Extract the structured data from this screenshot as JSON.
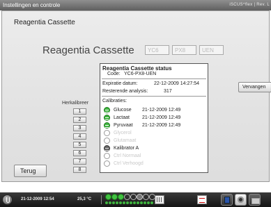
{
  "window": {
    "title": "Instellingen en controle",
    "brand": "iSCUS^flex | Rev. L"
  },
  "page": {
    "heading": "Reagentia Cassette"
  },
  "cassette": {
    "title": "Reagentia Cassette",
    "codes": [
      "YC6",
      "PX8",
      "UEN"
    ]
  },
  "status": {
    "title": "Reagentia Cassette status",
    "code_label": "Code:",
    "code_value": "YC6-PX8-UEN",
    "expiry_label": "Expiratie datum:",
    "expiry_value": "22-12-2009 14:27:54",
    "remaining_label": "Resterende analysis:",
    "remaining_value": "317",
    "calibrations_label": "Calibraties:",
    "calibrations": [
      {
        "name": "Glucose",
        "date": "21-12-2009 12:49",
        "state": "ok"
      },
      {
        "name": "Lactaat",
        "date": "21-12-2009 12:49",
        "state": "ok"
      },
      {
        "name": "Pyruvaat",
        "date": "21-12-2009 12:49",
        "state": "ok"
      },
      {
        "name": "Glycerol",
        "date": "",
        "state": "disabled"
      },
      {
        "name": "Glutamaat",
        "date": "",
        "state": "disabled"
      },
      {
        "name": "Kalibrator A",
        "date": "",
        "state": "dark"
      },
      {
        "name": "Ctrl Normaal",
        "date": "",
        "state": "disabled"
      },
      {
        "name": "Ctrl Verhoogd",
        "date": "",
        "state": "disabled"
      }
    ]
  },
  "recalibrate": {
    "label": "Herkalibreer",
    "buttons": [
      "1",
      "2",
      "3",
      "4",
      "5",
      "6",
      "7",
      "8"
    ]
  },
  "actions": {
    "replace_label": "Vervangen",
    "back_label": "Terug"
  },
  "taskbar": {
    "datetime": "21-12-2009 12:54",
    "temperature": "25,3 °C",
    "slots": [
      "ok",
      "ok",
      "ok",
      "empty",
      "empty",
      "dark",
      "empty",
      "empty"
    ]
  }
}
